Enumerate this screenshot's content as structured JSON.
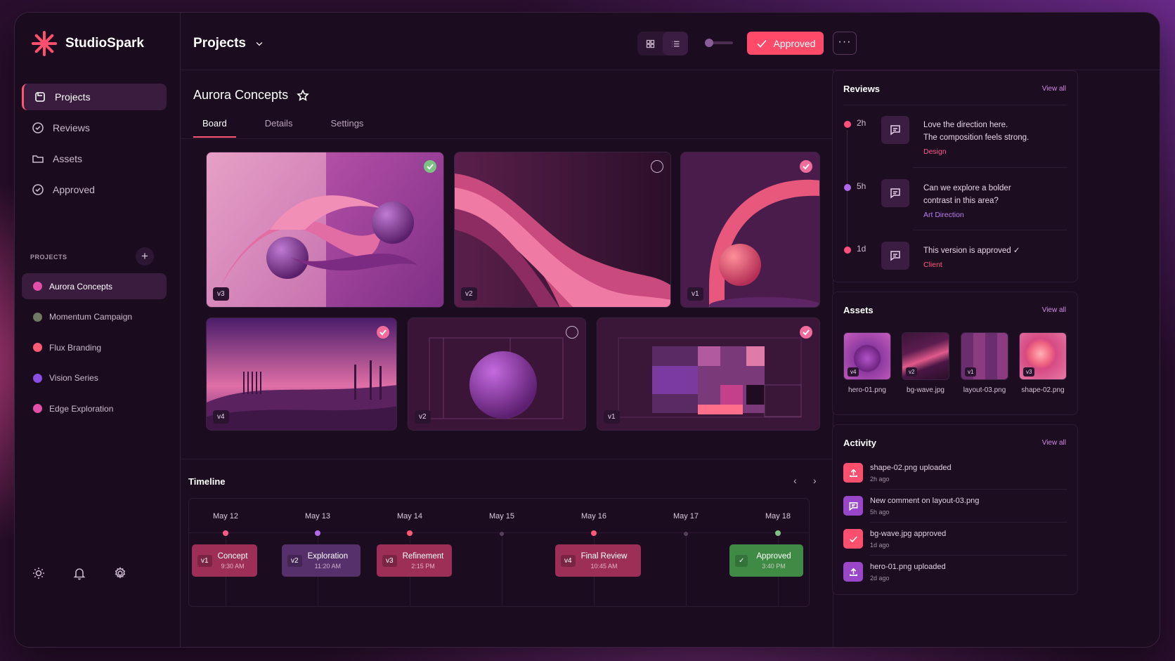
{
  "app": {
    "name": "StudioSpark"
  },
  "nav": [
    {
      "label": "Projects",
      "icon": "folder-icon"
    },
    {
      "label": "Reviews",
      "icon": "check-circle-icon"
    },
    {
      "label": "Assets",
      "icon": "folder-icon"
    },
    {
      "label": "Approved",
      "icon": "check-circle-icon"
    }
  ],
  "projects_section": {
    "label": "PROJECTS",
    "add": "+"
  },
  "projects": [
    {
      "label": "Aurora Concepts",
      "color": "#e24ea8"
    },
    {
      "label": "Momentum Campaign",
      "color": "#6f7a62"
    },
    {
      "label": "Flux Branding",
      "color": "#ff5a73"
    },
    {
      "label": "Vision Series",
      "color": "#8a4ee6"
    },
    {
      "label": "Edge Exploration",
      "color": "#e24ea8"
    }
  ],
  "header": {
    "title": "Projects",
    "approved_label": "Approved",
    "more_label": "···"
  },
  "project": {
    "title": "Aurora Concepts",
    "tabs": [
      "Board",
      "Details",
      "Settings"
    ]
  },
  "board": [
    {
      "version": "v3",
      "status": "approved"
    },
    {
      "version": "v2",
      "status": "pending"
    },
    {
      "version": "v1",
      "status": "approved"
    },
    {
      "version": "v4",
      "status": "approved"
    },
    {
      "version": "v2",
      "status": "pending"
    },
    {
      "version": "v1",
      "status": "approved"
    }
  ],
  "timeline": {
    "title": "Timeline",
    "dates": [
      "May 12",
      "May 13",
      "May 14",
      "May 15",
      "May 16",
      "May 17",
      "May 18"
    ],
    "events": [
      {
        "version": "v1",
        "title": "Concept",
        "time": "9:30 AM",
        "color": "#9d2f57"
      },
      {
        "version": "v2",
        "title": "Exploration",
        "time": "11:20 AM",
        "color": "#55306b"
      },
      {
        "version": "v3",
        "title": "Refinement",
        "time": "2:15 PM",
        "color": "#9d2f57"
      },
      {
        "version": "v4",
        "title": "Final Review",
        "time": "10:45 AM",
        "color": "#9d2f57"
      },
      {
        "version": "",
        "title": "Approved",
        "time": "3:40 PM",
        "color": "#3f8b45"
      }
    ]
  },
  "reviews": {
    "title": "Reviews",
    "view_all": "View all",
    "items": [
      {
        "time": "2h",
        "text1": "Love the direction here.",
        "text2": "The composition feels strong.",
        "tag": "Design",
        "dot": "#ff4f7a",
        "tag_color": "#ff5a8a"
      },
      {
        "time": "5h",
        "text1": "Can we explore a bolder",
        "text2": "contrast in this area?",
        "tag": "Art Direction",
        "dot": "#b069ea",
        "tag_color": "#b77ef0"
      },
      {
        "time": "1d",
        "text1": "This version is approved ✓",
        "text2": "",
        "tag": "Client",
        "dot": "#ff4f7a",
        "tag_color": "#ff5a7a"
      }
    ]
  },
  "assets": {
    "title": "Assets",
    "view_all": "View all",
    "items": [
      {
        "name": "hero-01.png",
        "version": "v4"
      },
      {
        "name": "bg-wave.jpg",
        "version": "v2"
      },
      {
        "name": "layout-03.png",
        "version": "v1"
      },
      {
        "name": "shape-02.png",
        "version": "v3"
      }
    ]
  },
  "activity": {
    "title": "Activity",
    "view_all": "View all",
    "items": [
      {
        "text": "shape-02.png uploaded",
        "time": "2h ago",
        "icon": "upload-icon",
        "color": "#ff4f6e"
      },
      {
        "text": "New comment on layout-03.png",
        "time": "5h ago",
        "icon": "comment-icon",
        "color": "#9a46c8"
      },
      {
        "text": "bg-wave.jpg approved",
        "time": "1d ago",
        "icon": "check-icon",
        "color": "#ff4f6e"
      },
      {
        "text": "hero-01.png uploaded",
        "time": "2d ago",
        "icon": "upload-icon",
        "color": "#9a46c8"
      }
    ]
  }
}
